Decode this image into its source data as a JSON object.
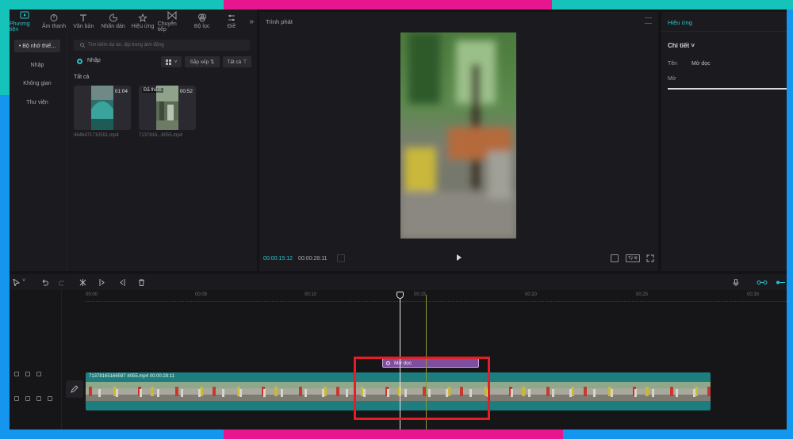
{
  "colors": {
    "accent": "#27c2c9",
    "effect_clip": "#7d4f9e",
    "video_track": "#1e7d7e",
    "highlight": "#e41e26",
    "frame_blue": "#1495ee",
    "frame_teal": "#16c3bb",
    "frame_magenta": "#e8168e"
  },
  "media_tabs": [
    {
      "label": "Phương tiện",
      "icon": "media-icon",
      "active": true
    },
    {
      "label": "Âm thanh",
      "icon": "audio-icon",
      "active": false
    },
    {
      "label": "Văn bản",
      "icon": "text-icon",
      "active": false
    },
    {
      "label": "Nhãn dán",
      "icon": "sticker-icon",
      "active": false
    },
    {
      "label": "Hiệu ứng",
      "icon": "effects-icon",
      "active": false
    },
    {
      "label": "Chuyển tiếp",
      "icon": "transition-icon",
      "active": false
    },
    {
      "label": "Bộ lọc",
      "icon": "filter-icon",
      "active": false
    },
    {
      "label": "Điề",
      "icon": "adjust-icon",
      "active": false
    }
  ],
  "more_tabs": "»",
  "sidebar": {
    "items": [
      {
        "label": "• Bộ nhớ thiế...",
        "active": true
      },
      {
        "label": "Nhập",
        "active": false
      },
      {
        "label": "Không gian",
        "active": false
      },
      {
        "label": "Thư viện",
        "active": false
      }
    ]
  },
  "library": {
    "search_placeholder": "Tìm kiếm dự án, tệp trong ảnh động",
    "import_label": "Nhập",
    "sort_label": "Sắp xếp ⇅",
    "filter_label": "Tất cả ⊤",
    "all_label": "Tất cả",
    "clips": [
      {
        "duration": "01:04",
        "badge": "",
        "name": "4646471710551.mp4"
      },
      {
        "duration": "00:52",
        "badge": "Đã thêm",
        "name": "7137816...8055.mp4"
      }
    ]
  },
  "player": {
    "title": "Trình phát",
    "current_time": "00:00:15:12",
    "total_time": "00:00:28:11",
    "ratio_label": "Tỷ lệ"
  },
  "properties": {
    "title": "Hiệu ứng",
    "detail_label": "Chi tiết ˅",
    "name_key": "Tên",
    "name_value": "Mờ dọc",
    "blur_label": "Mờ",
    "blur_level": 1.0
  },
  "timeline": {
    "ruler_labels": [
      "00:00",
      "00:05",
      "00:10",
      "00:15",
      "00:20",
      "00:25",
      "00:30"
    ],
    "effect_clip_label": "Mờ dọc",
    "video_clip_label": "71378165166597 8055.mp4   00:00:28:11"
  }
}
